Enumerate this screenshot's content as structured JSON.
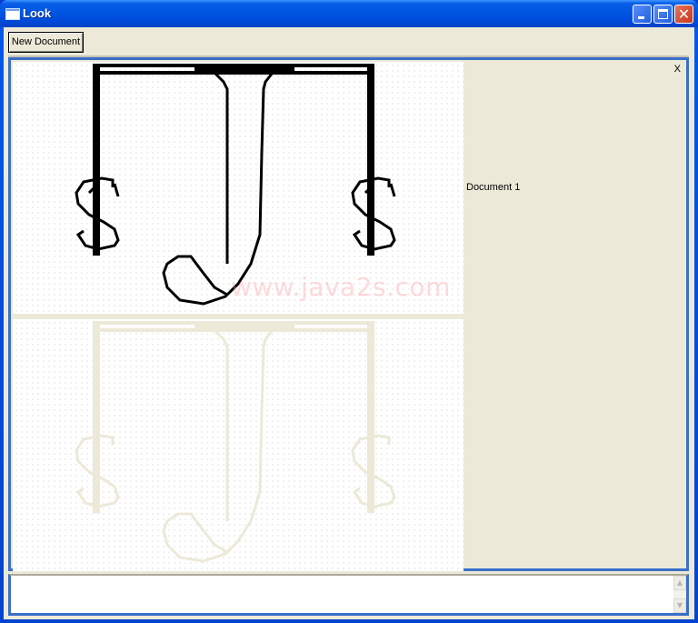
{
  "window": {
    "title": "Look",
    "controls": {
      "minimize": "minimize",
      "maximize": "maximize",
      "close": "✕"
    }
  },
  "toolbar": {
    "new_document_label": "New Document"
  },
  "desktop": {
    "close_label": "X",
    "document_label": "Document 1",
    "canvas_top": {
      "watermark": "www.java2s.com",
      "ink_color": "#000000"
    },
    "canvas_bottom": {
      "ink_color": "#ece9d8"
    }
  },
  "output_area": {
    "value": "",
    "scroll_up": "▲",
    "scroll_down": "▼"
  }
}
